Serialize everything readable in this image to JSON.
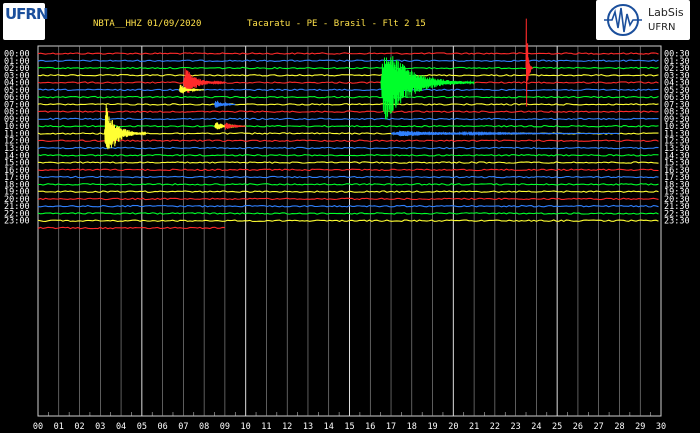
{
  "header": {
    "station": "NBTA__HHZ 01/09/2020",
    "location": "Tacaratu - PE - Brasil - Flt 2 15",
    "logo_left": "UFRN",
    "logo_right_line1": "LabSis",
    "logo_right_line2": "UFRN"
  },
  "chart_data": {
    "type": "line",
    "title": "NBTA__HHZ 01/09/2020",
    "subtitle": "Tacaratu - PE - Brasil - Flt 2 15",
    "x_ticks": [
      "00",
      "01",
      "02",
      "03",
      "04",
      "05",
      "06",
      "07",
      "08",
      "09",
      "10",
      "11",
      "12",
      "13",
      "14",
      "15",
      "16",
      "17",
      "18",
      "19",
      "20",
      "21",
      "22",
      "23",
      "24",
      "25",
      "26",
      "27",
      "28",
      "29",
      "30"
    ],
    "xlim": [
      0,
      30
    ],
    "left_labels": [
      "00:00",
      "01:00",
      "02:00",
      "03:00",
      "04:00",
      "05:00",
      "06:00",
      "07:00",
      "08:00",
      "09:00",
      "10:00",
      "11:00",
      "12:00",
      "13:00",
      "14:00",
      "15:00",
      "16:00",
      "17:00",
      "18:00",
      "19:00",
      "20:00",
      "21:00",
      "22:00",
      "23:00"
    ],
    "right_labels": [
      "00:30",
      "01:30",
      "02:30",
      "03:30",
      "04:30",
      "05:30",
      "06:30",
      "07:30",
      "08:30",
      "09:30",
      "10:30",
      "11:30",
      "12:30",
      "13:30",
      "14:30",
      "15:30",
      "16:30",
      "17:30",
      "18:30",
      "19:30",
      "20:30",
      "21:30",
      "22:30",
      "23:30"
    ],
    "trace_colors": [
      "#ff2a2a",
      "#2f80ff",
      "#00ff2a",
      "#ffff33"
    ],
    "trace_count": 25,
    "last_trace_end_min": 9,
    "events": [
      {
        "row": 2,
        "minute": 23.5,
        "amplitude": 60,
        "duration": 0.3,
        "color": "#ff2a2a"
      },
      {
        "row": 4,
        "minute": 16.5,
        "amplitude": 42,
        "duration": 4.5,
        "color": "#00ff2a"
      },
      {
        "row": 4,
        "minute": 7.0,
        "amplitude": 16,
        "duration": 2.0,
        "color": "#ff2a2a"
      },
      {
        "row": 5,
        "minute": 6.8,
        "amplitude": 6,
        "duration": 1.2,
        "color": "#ffff33"
      },
      {
        "row": 7,
        "minute": 8.5,
        "amplitude": 6,
        "duration": 1.0,
        "color": "#2f80ff"
      },
      {
        "row": 10,
        "minute": 8.5,
        "amplitude": 5,
        "duration": 1.5,
        "color": "#ffff33"
      },
      {
        "row": 10,
        "minute": 9.0,
        "amplitude": 5,
        "duration": 1.0,
        "color": "#ff2a2a"
      },
      {
        "row": 11,
        "minute": 3.2,
        "amplitude": 30,
        "duration": 2.0,
        "color": "#ffff33"
      },
      {
        "row": 11,
        "minute": 17.0,
        "amplitude": 3,
        "duration": 11.0,
        "color": "#2f80ff"
      }
    ],
    "grid": true
  }
}
